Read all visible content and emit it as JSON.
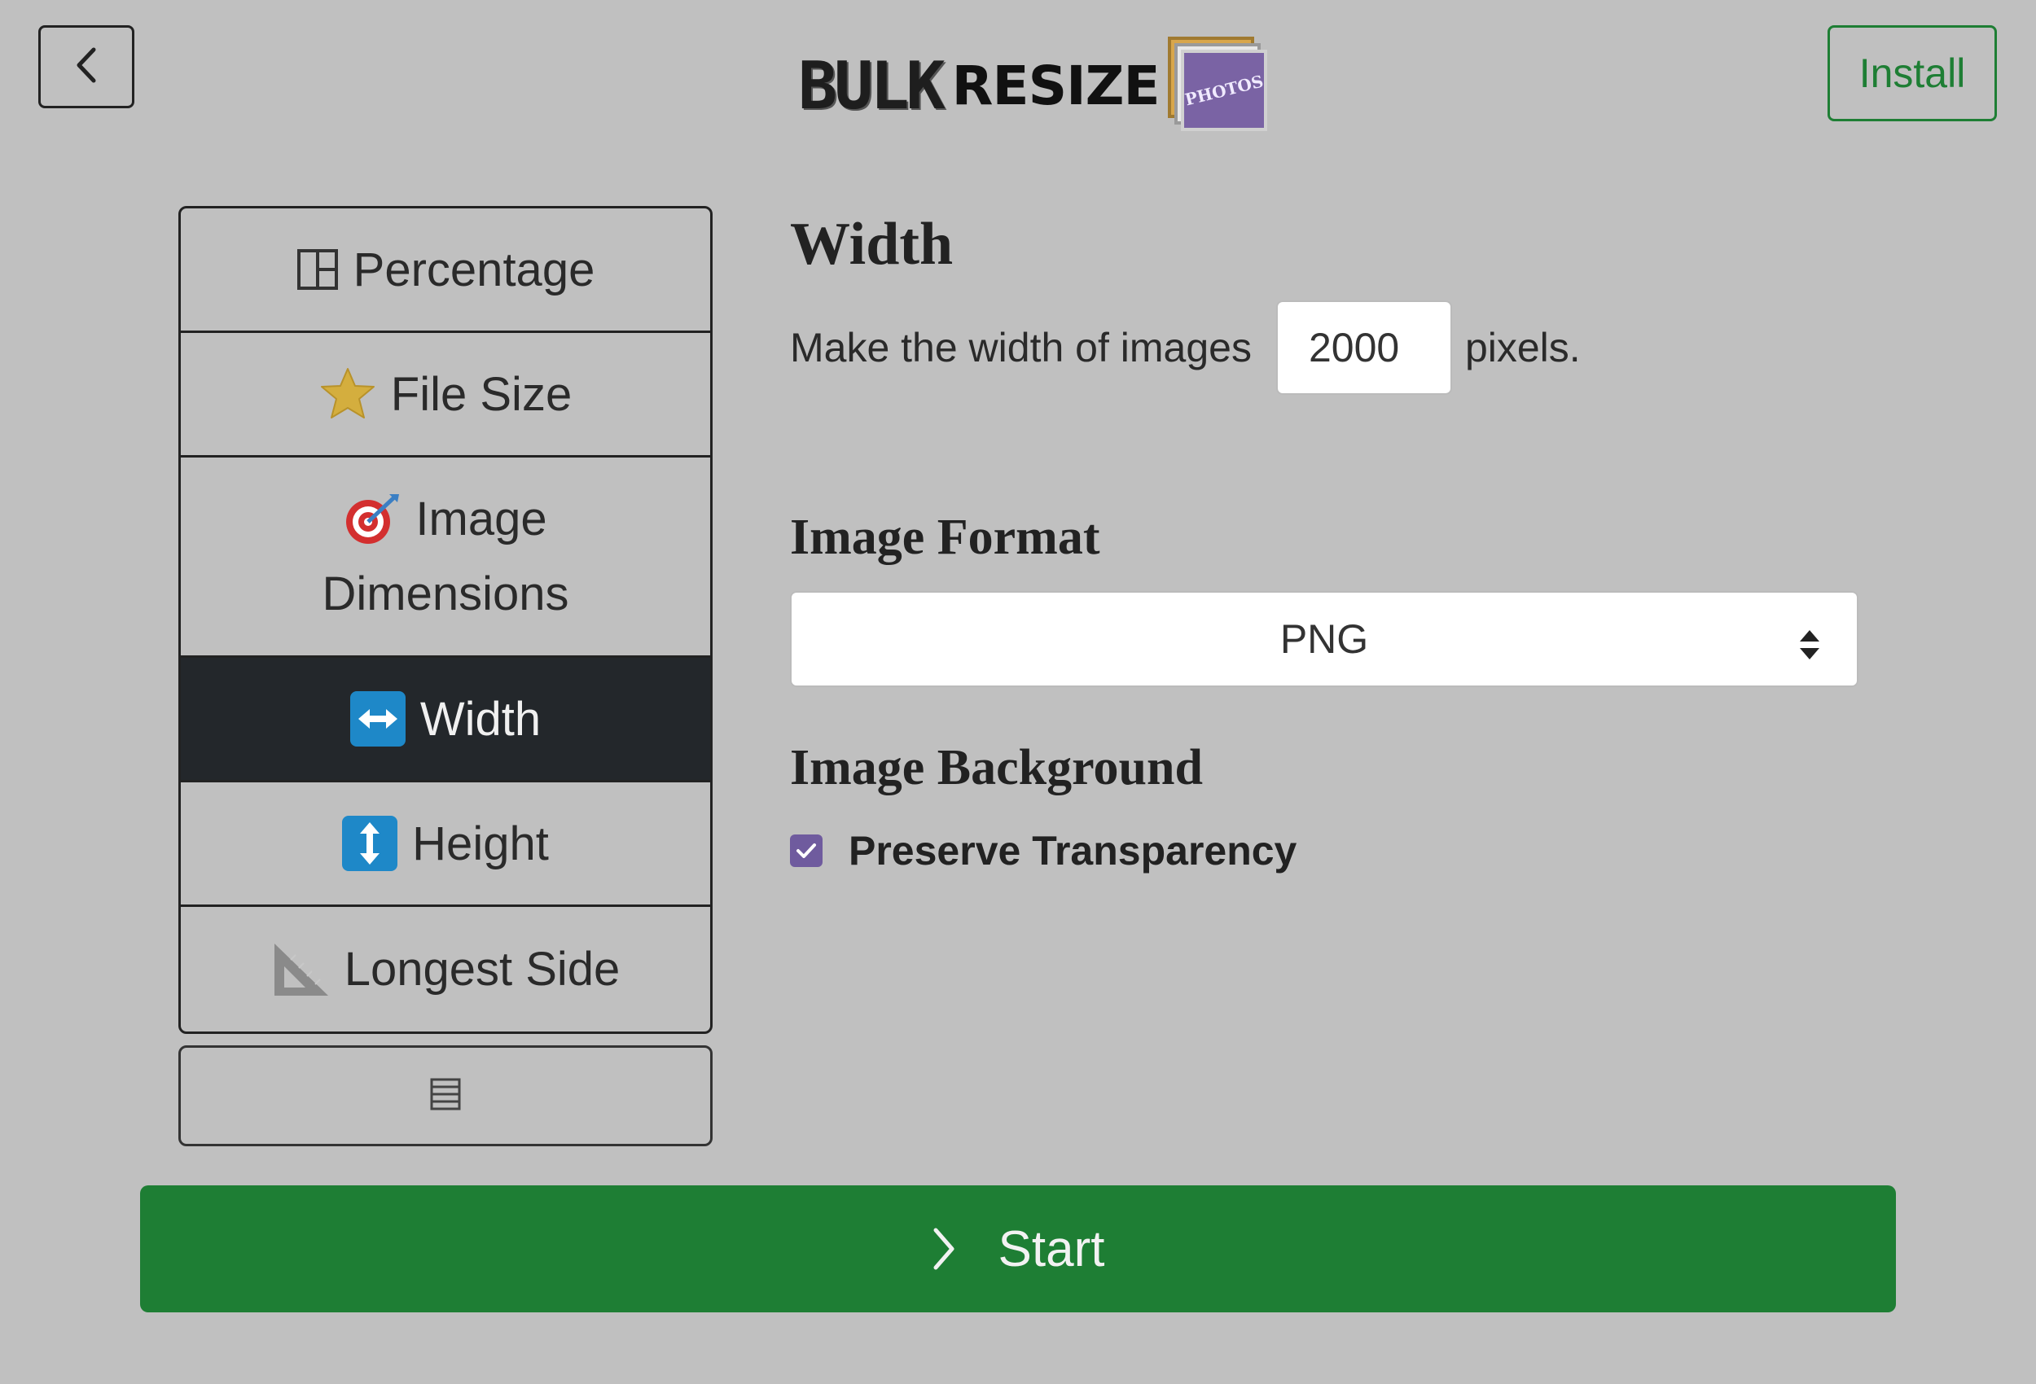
{
  "header": {
    "back_icon": "chevron-left-icon",
    "logo": {
      "word1": "BULK",
      "word2": "RESIZE",
      "badge": "PHOTOS"
    },
    "install_label": "Install"
  },
  "menu": {
    "items": [
      {
        "label": "Percentage",
        "icon": "percentage-icon",
        "active": false
      },
      {
        "label": "File Size",
        "icon": "star-icon",
        "active": false
      },
      {
        "label_line1": "Image",
        "label_line2": "Dimensions",
        "icon": "target-icon",
        "active": false
      },
      {
        "label": "Width",
        "icon": "left-right-arrow-icon",
        "active": true
      },
      {
        "label": "Height",
        "icon": "up-down-arrow-icon",
        "active": false
      },
      {
        "label": "Longest Side",
        "icon": "triangle-ruler-icon",
        "active": false
      }
    ],
    "more_icon": "list-icon"
  },
  "width_section": {
    "title": "Width",
    "prefix": "Make the width of images",
    "value": "2000",
    "suffix": "pixels."
  },
  "format_section": {
    "title": "Image Format",
    "selected": "PNG"
  },
  "background_section": {
    "title": "Image Background",
    "checkbox_label": "Preserve Transparency",
    "checked": true
  },
  "start_label": "Start",
  "colors": {
    "background": "#c0c0c0",
    "accent_green": "#1e7e34",
    "active_item": "#23272b",
    "checkbox": "#6f5b9e"
  }
}
